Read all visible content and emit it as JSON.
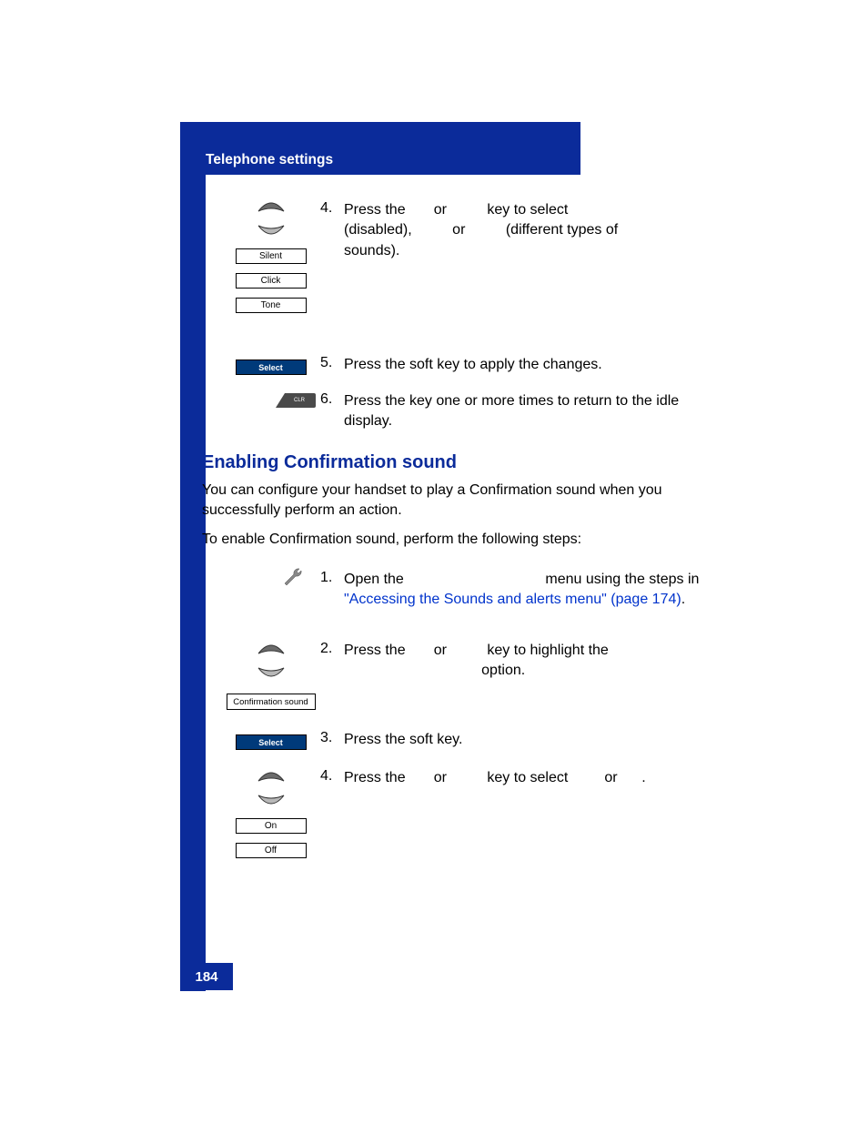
{
  "header": {
    "title": "Telephone settings"
  },
  "page_number": "184",
  "top_section": {
    "keys": {
      "silent": "Silent",
      "click": "Click",
      "tone": "Tone"
    },
    "select": "Select",
    "step4": {
      "num": "4.",
      "line1_a": "Press the ",
      "line1_b": " or ",
      "line1_c": " key to select ",
      "line2_a": "(disabled), ",
      "line2_b": " or ",
      "line2_c": " (different types of",
      "line3": "sounds)."
    },
    "step5": {
      "num": "5.",
      "text": "Press the          soft key to apply the changes."
    },
    "step6": {
      "num": "6.",
      "text": "Press the         key one or more times to return to the idle display."
    }
  },
  "heading": "Enabling Confirmation sound",
  "para1": "You can configure your handset to play a Confirmation sound when you successfully perform an action.",
  "para2": "To enable Confirmation sound, perform the following steps:",
  "bottom_section": {
    "step1": {
      "num": "1.",
      "a": "Open the ",
      "b": " menu using the steps in ",
      "link": "\"Accessing the Sounds and alerts menu\" (page 174)",
      "c": "."
    },
    "conf_label": "Confirmation sound",
    "step2": {
      "num": "2.",
      "a": "Press the ",
      "b": " or ",
      "c": " key to highlight the",
      "d": "option."
    },
    "select": "Select",
    "step3": {
      "num": "3.",
      "text": "Press the             soft key."
    },
    "step4b": {
      "num": "4.",
      "a": "Press the ",
      "b": " or ",
      "c": " key to select ",
      "d": " or ",
      "e": "."
    },
    "on": "On",
    "off": "Off"
  }
}
